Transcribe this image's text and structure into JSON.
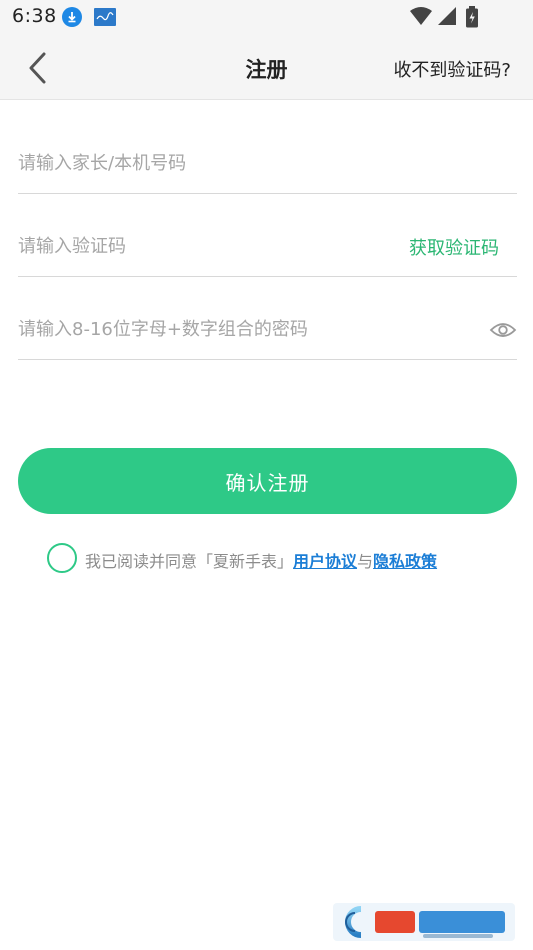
{
  "status_bar": {
    "time": "6:38",
    "icons": [
      "download-icon",
      "app-notification-icon",
      "wifi-icon",
      "signal-icon",
      "battery-charging-icon"
    ]
  },
  "nav": {
    "title": "注册",
    "help_link": "收不到验证码?",
    "back_icon": "chevron-left-icon"
  },
  "form": {
    "phone_placeholder": "请输入家长/本机号码",
    "phone_value": "",
    "code_placeholder": "请输入验证码",
    "code_value": "",
    "get_code_label": "获取验证码",
    "password_placeholder": "请输入8-16位字母+数字组合的密码",
    "password_value": "",
    "password_visibility_icon": "eye-icon"
  },
  "submit": {
    "label": "确认注册"
  },
  "agreement": {
    "prefix": "我已阅读并同意「夏新手表」",
    "user_agreement": "用户协议",
    "conjunction": "与",
    "privacy_policy": "隐私政策",
    "checked": false
  },
  "colors": {
    "accent": "#2ec987",
    "accent_text": "#2bb673",
    "link": "#1c7ed6",
    "placeholder": "#a6a6a6",
    "header_bg": "#f5f5f5"
  }
}
